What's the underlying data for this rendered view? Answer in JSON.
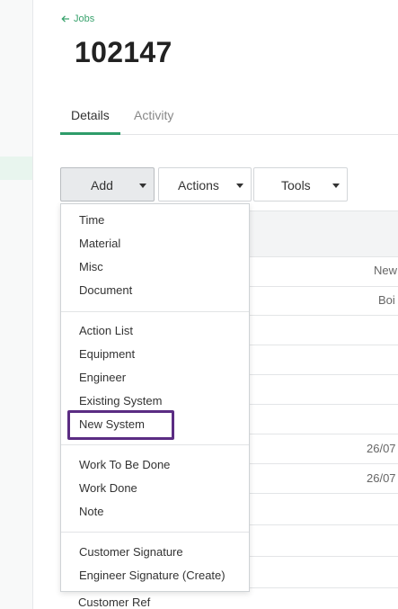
{
  "breadcrumb": {
    "back_label": "Jobs"
  },
  "page": {
    "title": "102147"
  },
  "tabs": [
    {
      "label": "Details",
      "active": true
    },
    {
      "label": "Activity",
      "active": false
    }
  ],
  "toolbar": {
    "add_label": "Add",
    "actions_label": "Actions",
    "tools_label": "Tools"
  },
  "add_menu": {
    "groups": [
      [
        "Time",
        "Material",
        "Misc",
        "Document"
      ],
      [
        "Action List",
        "Equipment",
        "Engineer",
        "Existing System",
        "New System"
      ],
      [
        "Work To Be Done",
        "Work Done",
        "Note"
      ],
      [
        "Customer Signature",
        "Engineer Signature (Create)"
      ]
    ],
    "highlighted_item": "New System"
  },
  "background": {
    "cells": [
      "New",
      "Boi",
      "26/07",
      "26/07"
    ],
    "footer_label": "Customer Ref"
  },
  "colors": {
    "accent": "#2f9c6a",
    "highlight": "#5b2c83"
  }
}
